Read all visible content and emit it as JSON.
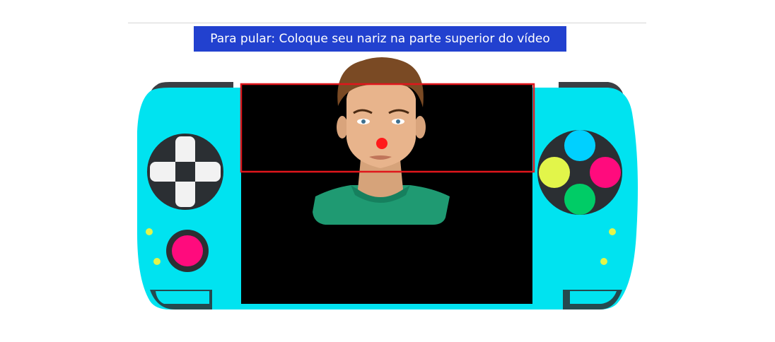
{
  "banner": {
    "text": "Para pular: Coloque seu nariz na parte superior do vídeo"
  },
  "colors": {
    "banner_bg": "#2241cf",
    "console_body": "#00e3f0",
    "console_outline": "#2b2f33",
    "screen_bg": "#000000",
    "target_zone_border": "#e0161c",
    "nose_marker": "#ff1a1a",
    "button_blue": "#00d0ff",
    "button_pink": "#ff0b7d",
    "button_green": "#00cc66",
    "button_yellow": "#e2f54a",
    "dpad": "#f2f2f2"
  },
  "icons": {
    "dpad": "dpad-icon",
    "action_buttons": "action-buttons-icon",
    "nose_marker": "nose-dot-icon"
  }
}
